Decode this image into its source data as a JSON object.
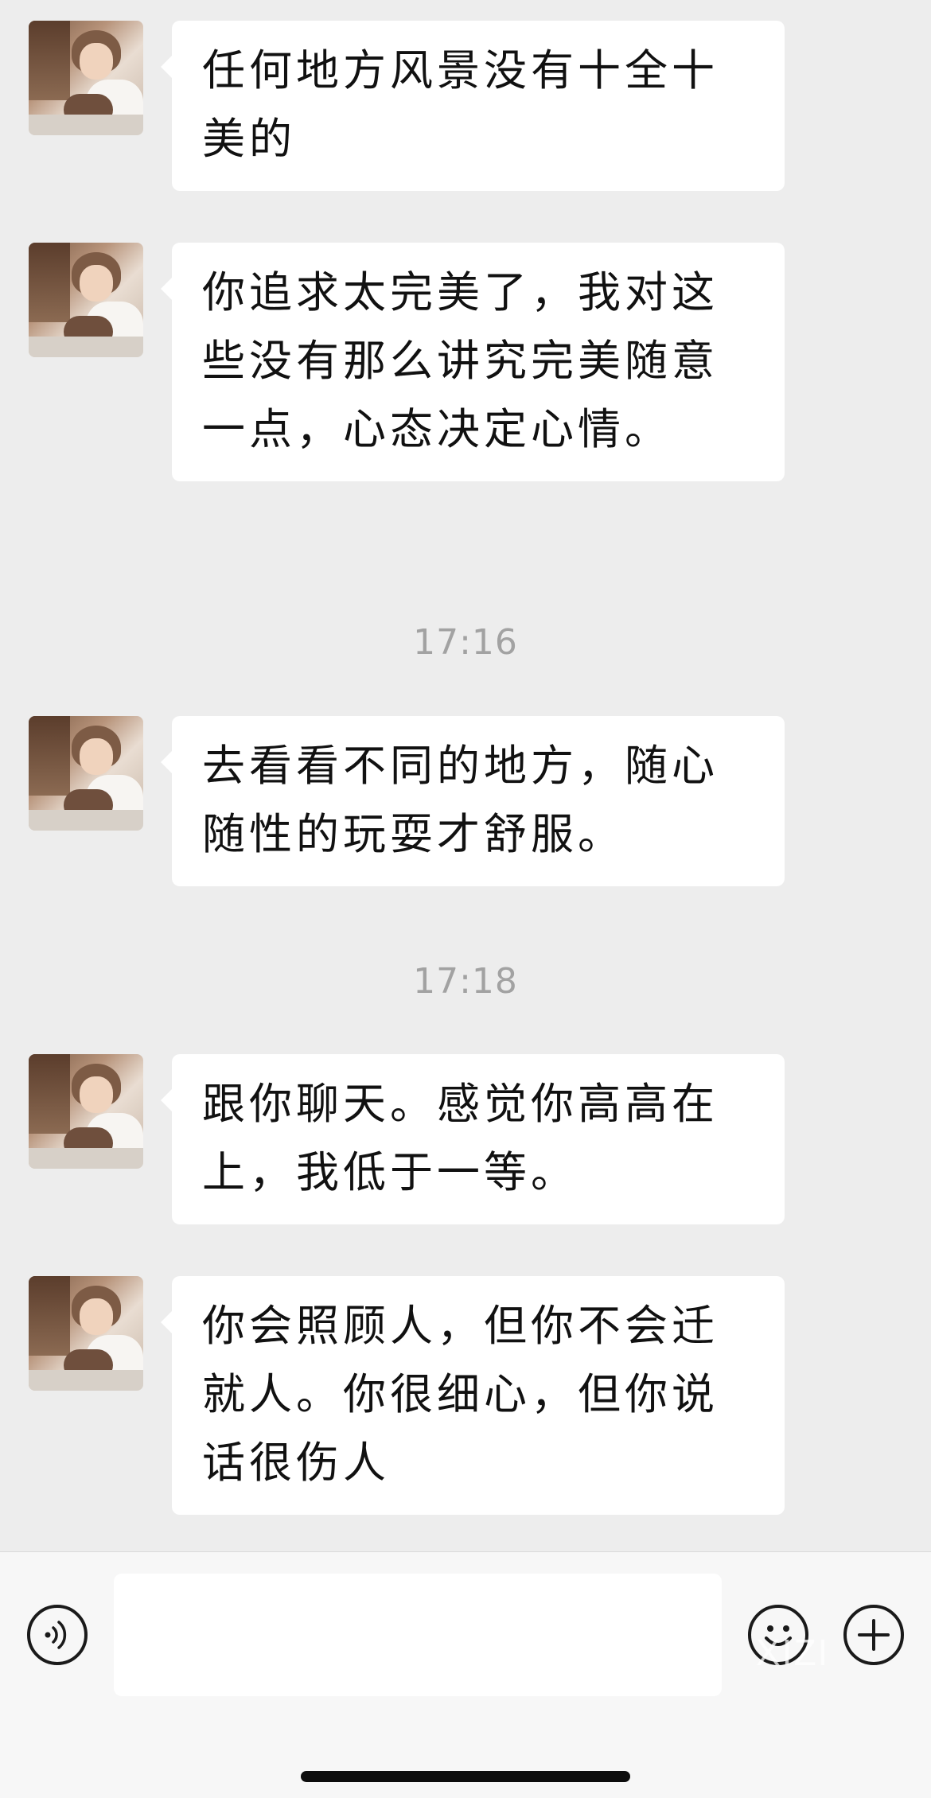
{
  "messages": [
    {
      "text": "任何地方风景没有十全十美的"
    },
    {
      "text": "你追求太完美了，我对这些没有那么讲究完美随意一点，心态决定心情。"
    },
    {
      "text": "去看看不同的地方，随心随性的玩耍才舒服。"
    },
    {
      "text": "跟你聊天。感觉你高高在上，我低于一等。"
    },
    {
      "text": "你会照顾人，但你不会迁就人。你很细心，但你说话很伤人"
    }
  ],
  "timestamps": [
    "17:16",
    "17:18"
  ],
  "input_bar": {
    "voice_icon": "voice-icon",
    "emoji_icon": "emoji-icon",
    "plus_icon": "plus-icon",
    "message_value": ""
  },
  "watermark": "XIZI"
}
